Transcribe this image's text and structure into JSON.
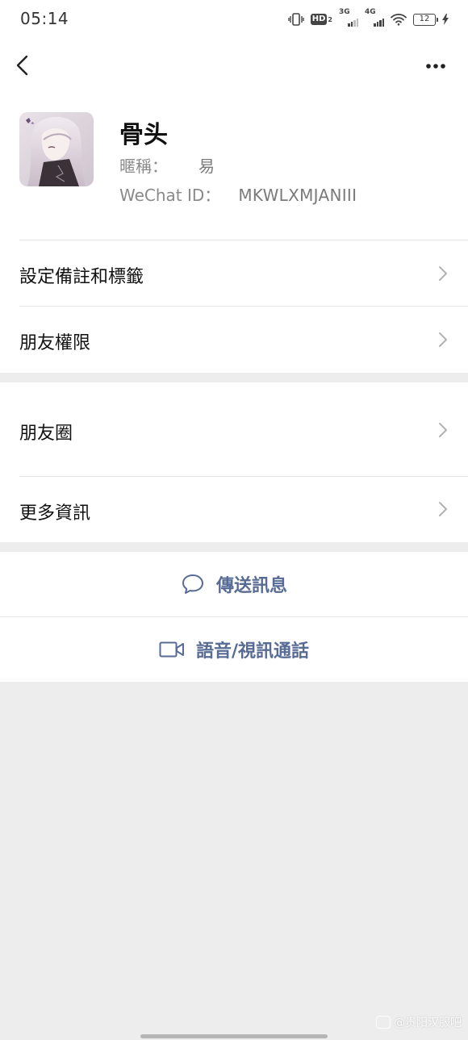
{
  "status_bar": {
    "time": "05:14",
    "hd_label": "HD",
    "hd_sub": "2",
    "net1": "3G",
    "net2": "4G",
    "battery": "12"
  },
  "nav": {
    "back_icon": "chevron-left-icon",
    "more_icon": "more-dots-icon"
  },
  "profile": {
    "name": "骨头",
    "nickname_label": "暱稱：",
    "nickname_value": "易",
    "wechat_id_label": "WeChat ID：",
    "wechat_id_value": "MKWLXMJANIII"
  },
  "menu": {
    "set_remark": "設定備註和標籤",
    "friend_permissions": "朋友權限",
    "moments": "朋友圈",
    "more_info": "更多資訊"
  },
  "actions": {
    "send_message": "傳送訊息",
    "voice_video_call": "語音/視訊通話"
  },
  "watermark": "@贵阳汉服吧",
  "colors": {
    "accent": "#576b95",
    "background": "#ededed",
    "divider": "#e5e5e5"
  }
}
